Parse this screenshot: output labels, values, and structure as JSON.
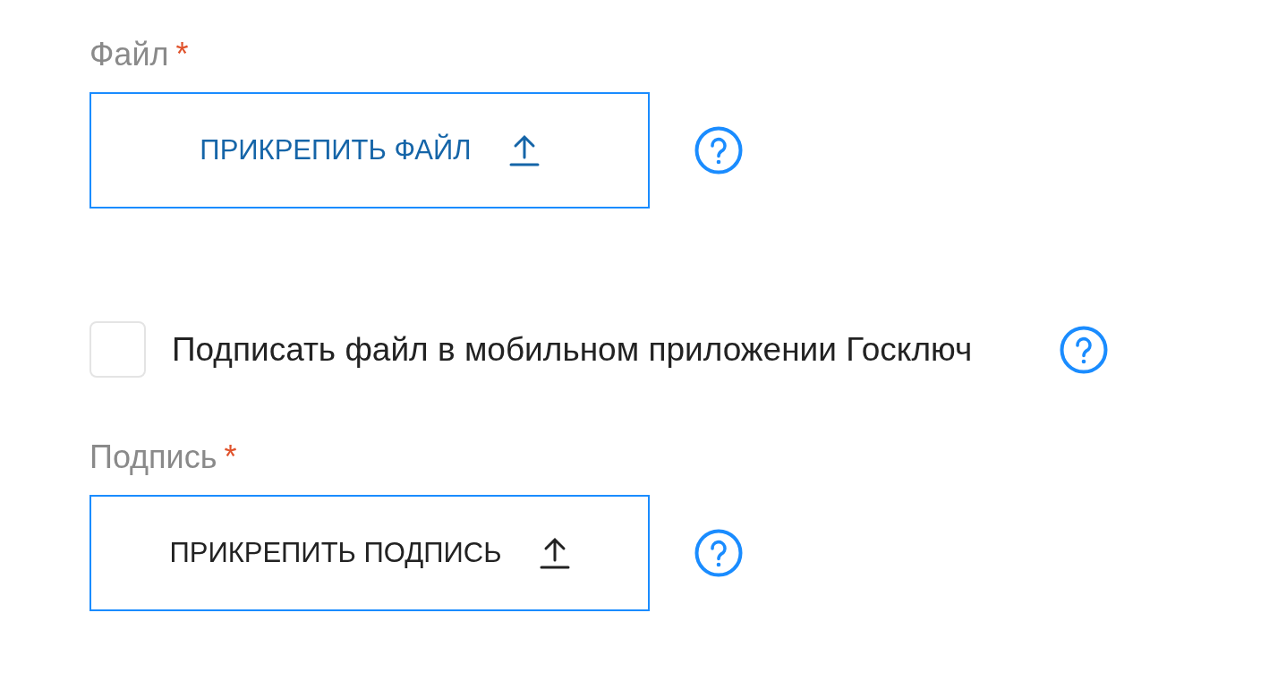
{
  "fields": [
    {
      "kind": "upload",
      "label": "Файл",
      "required_mark": "*",
      "button": "ПРИКРЕПИТЬ ФАЙЛ",
      "highlighted": true
    },
    {
      "kind": "checkbox",
      "label": "Подписать файл в мобильном приложении Госключ",
      "checked": false
    },
    {
      "kind": "upload",
      "label": "Подпись",
      "required_mark": "*",
      "button": "ПРИКРЕПИТЬ ПОДПИСЬ",
      "highlighted": false
    }
  ]
}
